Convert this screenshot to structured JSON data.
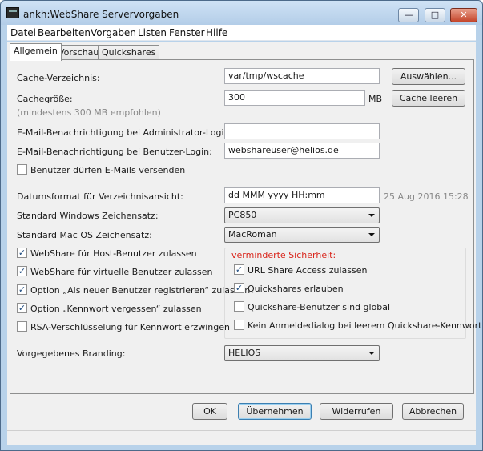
{
  "window": {
    "title": "ankh:WebShare Servervorgaben",
    "controls": {
      "minimize": "—",
      "maximize": "□",
      "close": "✕"
    }
  },
  "menu": [
    "Datei",
    "Bearbeiten",
    "Vorgaben",
    "Listen",
    "Fenster",
    "Hilfe"
  ],
  "tabs": [
    "Allgemein",
    "Vorschau",
    "Quickshares"
  ],
  "form": {
    "cache_dir": {
      "label": "Cache-Verzeichnis:",
      "value": "var/tmp/wscache",
      "button": "Auswählen..."
    },
    "cache_size": {
      "label": "Cachegröße:",
      "value": "300",
      "unit": "MB",
      "hint": "(mindestens 300 MB empfohlen)",
      "button": "Cache leeren"
    },
    "admin_email": {
      "label": "E-Mail-Benachrichtigung bei Administrator-Login:",
      "value": ""
    },
    "user_email": {
      "label": "E-Mail-Benachrichtigung bei Benutzer-Login:",
      "value": "webshareuser@helios.de"
    },
    "users_send_email": {
      "label": "Benutzer dürfen E-Mails versenden",
      "checked": false
    },
    "date_format": {
      "label": "Datumsformat für Verzeichnisansicht:",
      "value": "dd MMM yyyy HH:mm",
      "preview": "25 Aug 2016 15:28"
    },
    "win_charset": {
      "label": "Standard Windows Zeichensatz:",
      "value": "PC850"
    },
    "mac_charset": {
      "label": "Standard Mac OS Zeichensatz:",
      "value": "MacRoman"
    },
    "left_checks": [
      {
        "label": "WebShare für Host-Benutzer zulassen",
        "checked": true
      },
      {
        "label": "WebShare für virtuelle Benutzer zulassen",
        "checked": true
      },
      {
        "label": "Option „Als neuer Benutzer registrieren“ zulassen",
        "checked": true
      },
      {
        "label": "Option „Kennwort vergessen“ zulassen",
        "checked": true
      },
      {
        "label": "RSA-Verschlüsselung für Kennwort erzwingen",
        "checked": false
      }
    ],
    "security_group": {
      "title": "verminderte Sicherheit:",
      "checks": [
        {
          "label": "URL Share Access zulassen",
          "checked": true
        },
        {
          "label": "Quickshares erlauben",
          "checked": true
        },
        {
          "label": "Quickshare-Benutzer sind global",
          "checked": false
        },
        {
          "label": "Kein Anmeldedialog bei leerem Quickshare-Kennwort",
          "checked": false
        }
      ]
    },
    "branding": {
      "label": "Vorgegebenes Branding:",
      "value": "HELIOS"
    }
  },
  "buttons": {
    "ok": "OK",
    "apply": "Übernehmen",
    "revert": "Widerrufen",
    "cancel": "Abbrechen"
  },
  "colors": {
    "security_title": "#d9261c",
    "checkmark": "#1e4b80"
  }
}
